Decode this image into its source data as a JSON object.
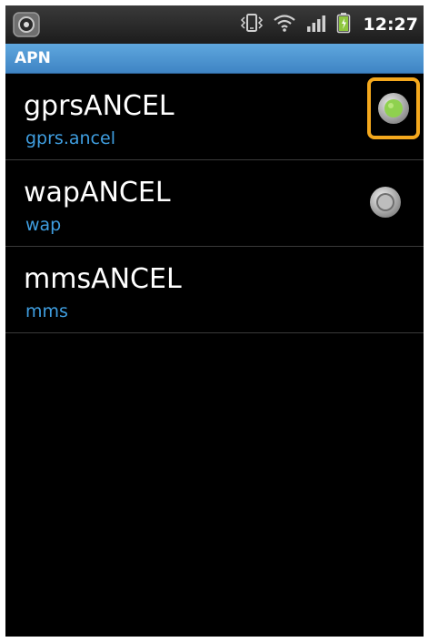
{
  "status_bar": {
    "time": "12:27",
    "icons": [
      "app-notification-icon",
      "vibrate-icon",
      "wifi-icon",
      "signal-icon",
      "battery-icon"
    ],
    "battery_color": "#8ec63f"
  },
  "header": {
    "title": "APN"
  },
  "apn_list": [
    {
      "name": "gprsANCEL",
      "apn": "gprs.ancel",
      "selected": true
    },
    {
      "name": "wapANCEL",
      "apn": "wap",
      "selected": false
    },
    {
      "name": "mmsANCEL",
      "apn": "mms",
      "selected": null
    }
  ],
  "colors": {
    "accent": "#3f9ee0",
    "title_bar": "#4a90d0",
    "radio_selected": "#8fd14f",
    "focus_ring": "#f4a81d"
  }
}
